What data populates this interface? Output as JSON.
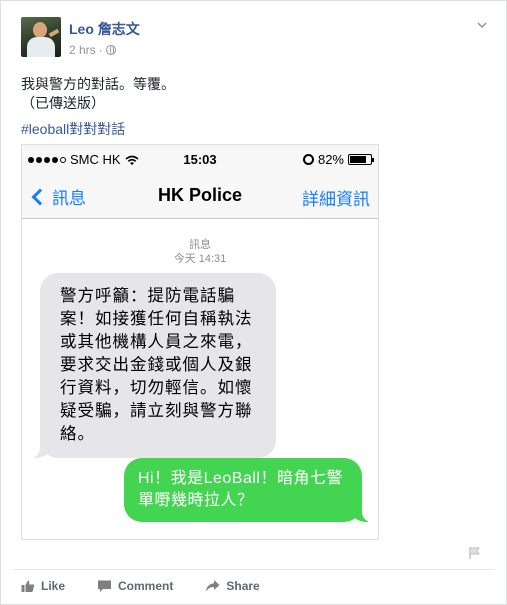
{
  "post": {
    "author": "Leo 詹志文",
    "time": "2 hrs",
    "separator": "·",
    "text_lines": [
      "我與警方的對話。等覆。",
      "（已傳送版）"
    ],
    "hashtag": "#leoball對對對話"
  },
  "phone": {
    "status": {
      "carrier": "SMC HK",
      "time": "15:03",
      "battery": "82%",
      "battery_level": 0.82
    },
    "nav": {
      "back_label": "訊息",
      "title": "HK Police",
      "details_label": "詳細資訊"
    },
    "conversation": {
      "label": "訊息",
      "timestamp": "今天 14:31",
      "incoming_message": "警方呼籲：提防電話騙案！如接獲任何自稱執法或其他機構人員之來電，要求交出金錢或個人及銀行資料，切勿輕信。如懷疑受騙，請立刻與警方聯絡。",
      "outgoing_message": "Hi！我是LeoBall！暗角七警單嘢幾時拉人？"
    }
  },
  "actions": {
    "like": "Like",
    "comment": "Comment",
    "share": "Share"
  },
  "colors": {
    "link_blue": "#365899",
    "ios_blue": "#147efb",
    "bubble_gray": "#e5e5ea",
    "bubble_green": "#43d551"
  }
}
